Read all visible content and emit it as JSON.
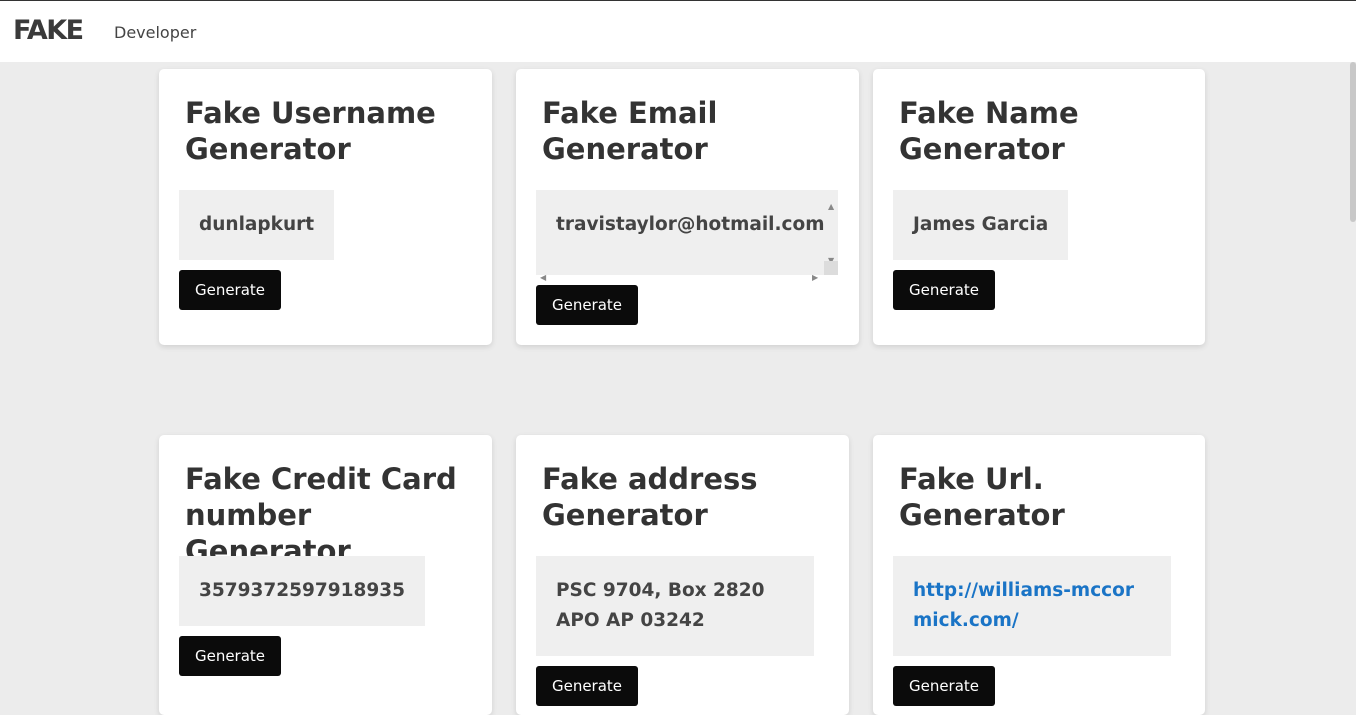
{
  "header": {
    "logo": "FAKE",
    "nav_link": "Developer"
  },
  "cards": [
    {
      "title": "Fake Username Generator",
      "value": "dunlapkurt",
      "button": "Generate"
    },
    {
      "title": "Fake Email Generator",
      "value": "travistaylor@hotmail.com",
      "button": "Generate"
    },
    {
      "title": "Fake Name Generator",
      "value": "James Garcia",
      "button": "Generate"
    },
    {
      "title": "Fake Credit Card number Generator",
      "value": "3579372597918935",
      "button": "Generate"
    },
    {
      "title": "Fake address Generator",
      "value": "PSC 9704, Box 2820 APO AP 03242",
      "button": "Generate"
    },
    {
      "title": "Fake Url. Generator",
      "value": "http://williams-mccormick.com/",
      "button": "Generate"
    }
  ],
  "colors": {
    "button_bg": "#0b0b0b",
    "link": "#1a74c6",
    "page_bg": "#ececec"
  }
}
